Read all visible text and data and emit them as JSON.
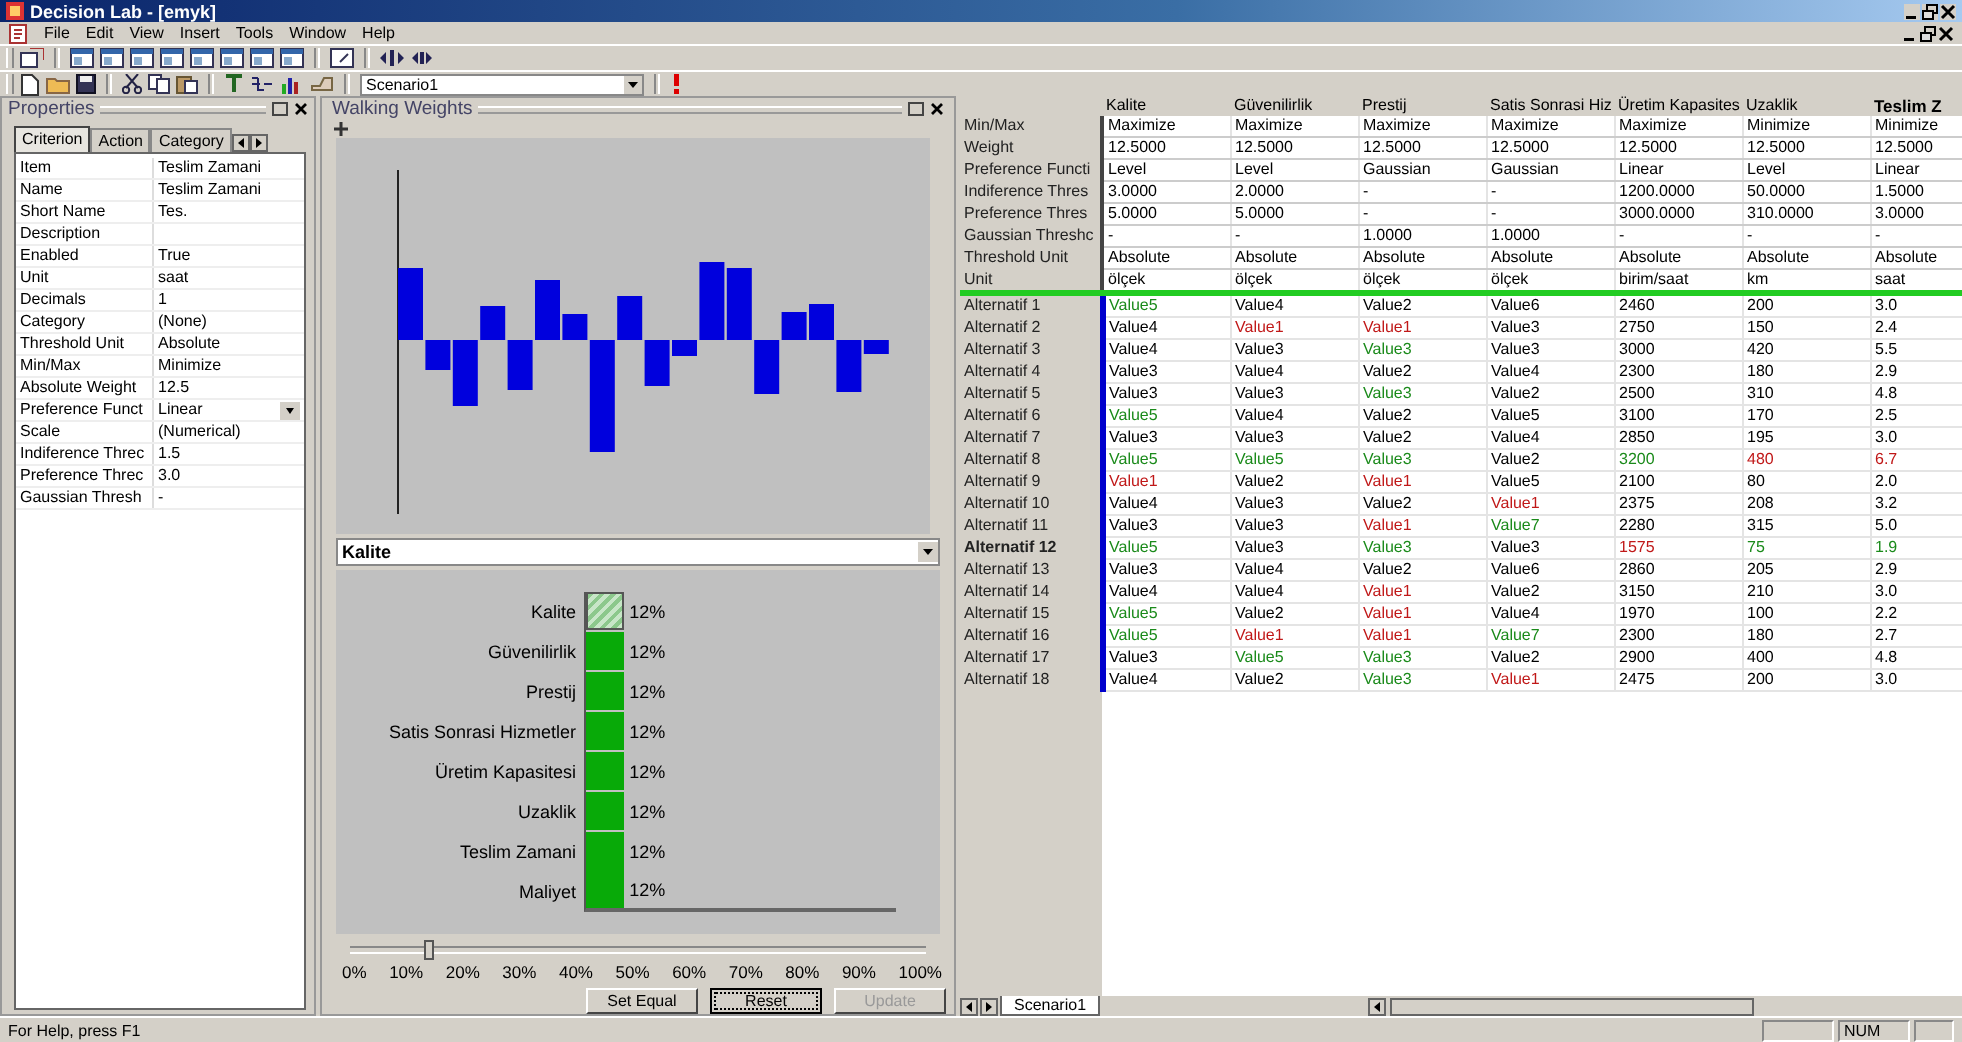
{
  "window": {
    "title": "Decision Lab - [emyk]"
  },
  "menu": [
    "File",
    "Edit",
    "View",
    "Insert",
    "Tools",
    "Window",
    "Help"
  ],
  "toolbar": {
    "scenario": "Scenario1"
  },
  "properties": {
    "title": "Properties",
    "tabs": [
      {
        "label": "Criterion",
        "selected": true
      },
      {
        "label": "Action",
        "selected": false
      },
      {
        "label": "Category",
        "selected": false
      }
    ],
    "rows": [
      {
        "name": "Item",
        "value": "Teslim Zamani",
        "kind": "text"
      },
      {
        "name": "Name",
        "value": "Teslim Zamani",
        "kind": "text"
      },
      {
        "name": "Short Name",
        "value": "Tes.",
        "kind": "text"
      },
      {
        "name": "Description",
        "kind": "text"
      },
      {
        "name": "Enabled",
        "value": "True",
        "kind": "text"
      },
      {
        "name": "Unit",
        "value": "saat",
        "kind": "text"
      },
      {
        "name": "Decimals",
        "value": "1",
        "kind": "text"
      },
      {
        "name": "Category",
        "value": "(None)",
        "kind": "text"
      },
      {
        "name": "Threshold Unit",
        "value": "Absolute",
        "kind": "text"
      },
      {
        "name": "Min/Max",
        "value": "Minimize",
        "kind": "text"
      },
      {
        "name": "Absolute Weight",
        "value": "12.5",
        "kind": "text"
      },
      {
        "name": "Preference Funct",
        "value": "Linear",
        "kind": "dropdown"
      },
      {
        "name": "Scale",
        "value": "(Numerical)",
        "kind": "text"
      },
      {
        "name": "Indiference Threc",
        "value": "1.5",
        "kind": "text"
      },
      {
        "name": "Preference Threc",
        "value": "3.0",
        "kind": "text"
      },
      {
        "name": "Gaussian Thresh",
        "value": "-",
        "kind": "text"
      }
    ]
  },
  "walking_weights": {
    "title": "Walking Weights",
    "criterion": "Kalite",
    "weights": [
      {
        "name": "Kalite",
        "percent": "12%",
        "level": 0.12,
        "selected": true
      },
      {
        "name": "Güvenilirlik",
        "percent": "12%",
        "level": 0.12,
        "selected": false
      },
      {
        "name": "Prestij",
        "percent": "12%",
        "level": 0.12,
        "selected": false
      },
      {
        "name": "Satis Sonrasi Hizmetler",
        "percent": "12%",
        "level": 0.12,
        "selected": false
      },
      {
        "name": "Üretim Kapasitesi",
        "percent": "12%",
        "level": 0.12,
        "selected": false
      },
      {
        "name": "Uzaklik",
        "percent": "12%",
        "level": 0.12,
        "selected": false
      },
      {
        "name": "Teslim Zamani",
        "percent": "12%",
        "level": 0.12,
        "selected": false
      },
      {
        "name": "Maliyet",
        "percent": "12%",
        "level": 0.12,
        "selected": false
      }
    ],
    "slider": {
      "level": 0.13,
      "ticks": [
        "0%",
        "10%",
        "20%",
        "30%",
        "40%",
        "50%",
        "60%",
        "70%",
        "80%",
        "90%",
        "100%"
      ]
    },
    "buttons": [
      {
        "label": "Set Equal",
        "disabled": false,
        "focused": false
      },
      {
        "label": "Reset",
        "disabled": false,
        "focused": true
      },
      {
        "label": "Update",
        "disabled": true,
        "focused": false
      }
    ]
  },
  "table": {
    "columns": [
      {
        "label": "Kalite",
        "selected": false
      },
      {
        "label": "Güvenilirlik",
        "selected": false
      },
      {
        "label": "Prestij",
        "selected": false
      },
      {
        "label": "Satis Sonrasi Hiz",
        "selected": false
      },
      {
        "label": "Üretim Kapasites",
        "selected": false
      },
      {
        "label": "Uzaklik",
        "selected": false
      },
      {
        "label": "Teslim Z",
        "selected": true
      }
    ],
    "settings": [
      {
        "label": "Min/Max",
        "cells": [
          "Maximize",
          "Maximize",
          "Maximize",
          "Maximize",
          "Maximize",
          "Minimize",
          "Minimize"
        ]
      },
      {
        "label": "Weight",
        "cells": [
          "12.5000",
          "12.5000",
          "12.5000",
          "12.5000",
          "12.5000",
          "12.5000",
          "12.5000"
        ]
      },
      {
        "label": "Preference Functi",
        "cells": [
          "Level",
          "Level",
          "Gaussian",
          "Gaussian",
          "Linear",
          "Level",
          "Linear"
        ]
      },
      {
        "label": "Indiference Thres",
        "cells": [
          "3.0000",
          "2.0000",
          "-",
          "-",
          "1200.0000",
          "50.0000",
          "1.5000"
        ]
      },
      {
        "label": "Preference Thres",
        "cells": [
          "5.0000",
          "5.0000",
          "-",
          "-",
          "3000.0000",
          "310.0000",
          "3.0000"
        ]
      },
      {
        "label": "Gaussian Threshc",
        "cells": [
          "-",
          "-",
          "1.0000",
          "1.0000",
          "-",
          "-",
          "-"
        ]
      },
      {
        "label": "Threshold Unit",
        "cells": [
          "Absolute",
          "Absolute",
          "Absolute",
          "Absolute",
          "Absolute",
          "Absolute",
          "Absolute"
        ]
      },
      {
        "label": "Unit",
        "cells": [
          "ölçek",
          "ölçek",
          "ölçek",
          "ölçek",
          "birim/saat",
          "km",
          "saat"
        ]
      }
    ],
    "rows": [
      {
        "label": "Alternatif 1",
        "selected": false,
        "cells": [
          {
            "text": "Value5",
            "color": "#1a8a1a"
          },
          "Value4",
          "Value2",
          "Value6",
          "2460",
          "200",
          "3.0"
        ]
      },
      {
        "label": "Alternatif 2",
        "selected": false,
        "cells": [
          "Value4",
          {
            "text": "Value1",
            "color": "#c01818"
          },
          {
            "text": "Value1",
            "color": "#c01818"
          },
          "Value3",
          "2750",
          "150",
          "2.4"
        ]
      },
      {
        "label": "Alternatif 3",
        "selected": false,
        "cells": [
          "Value4",
          "Value3",
          {
            "text": "Value3",
            "color": "#1a8a1a"
          },
          "Value3",
          "3000",
          "420",
          "5.5"
        ]
      },
      {
        "label": "Alternatif 4",
        "selected": false,
        "cells": [
          "Value3",
          "Value4",
          "Value2",
          "Value4",
          "2300",
          "180",
          "2.9"
        ]
      },
      {
        "label": "Alternatif 5",
        "selected": false,
        "cells": [
          "Value3",
          "Value3",
          {
            "text": "Value3",
            "color": "#1a8a1a"
          },
          "Value2",
          "2500",
          "310",
          "4.8"
        ]
      },
      {
        "label": "Alternatif 6",
        "selected": false,
        "cells": [
          {
            "text": "Value5",
            "color": "#1a8a1a"
          },
          "Value4",
          "Value2",
          "Value5",
          "3100",
          "170",
          "2.5"
        ]
      },
      {
        "label": "Alternatif 7",
        "selected": false,
        "cells": [
          "Value3",
          "Value3",
          "Value2",
          "Value4",
          "2850",
          "195",
          "3.0"
        ]
      },
      {
        "label": "Alternatif 8",
        "selected": false,
        "cells": [
          {
            "text": "Value5",
            "color": "#1a8a1a"
          },
          {
            "text": "Value5",
            "color": "#1a8a1a"
          },
          {
            "text": "Value3",
            "color": "#1a8a1a"
          },
          "Value2",
          {
            "text": "3200",
            "color": "#1a8a1a"
          },
          {
            "text": "480",
            "color": "#c01818"
          },
          {
            "text": "6.7",
            "color": "#c01818"
          }
        ]
      },
      {
        "label": "Alternatif 9",
        "selected": false,
        "cells": [
          {
            "text": "Value1",
            "color": "#c01818"
          },
          "Value2",
          {
            "text": "Value1",
            "color": "#c01818"
          },
          "Value5",
          "2100",
          "80",
          "2.0"
        ]
      },
      {
        "label": "Alternatif 10",
        "selected": false,
        "cells": [
          "Value4",
          "Value3",
          "Value2",
          {
            "text": "Value1",
            "color": "#c01818"
          },
          "2375",
          "208",
          "3.2"
        ]
      },
      {
        "label": "Alternatif 11",
        "selected": false,
        "cells": [
          "Value3",
          "Value3",
          {
            "text": "Value1",
            "color": "#c01818"
          },
          {
            "text": "Value7",
            "color": "#1a8a1a"
          },
          "2280",
          "315",
          "5.0"
        ]
      },
      {
        "label": "Alternatif 12",
        "selected": true,
        "cells": [
          {
            "text": "Value5",
            "color": "#1a8a1a"
          },
          "Value3",
          {
            "text": "Value3",
            "color": "#1a8a1a"
          },
          "Value3",
          {
            "text": "1575",
            "color": "#c01818"
          },
          {
            "text": "75",
            "color": "#1a8a1a"
          },
          {
            "text": "1.9",
            "color": "#1a8a1a"
          }
        ]
      },
      {
        "label": "Alternatif 13",
        "selected": false,
        "cells": [
          "Value3",
          "Value4",
          "Value2",
          "Value6",
          "2860",
          "205",
          "2.9"
        ]
      },
      {
        "label": "Alternatif 14",
        "selected": false,
        "cells": [
          "Value4",
          "Value4",
          {
            "text": "Value1",
            "color": "#c01818"
          },
          "Value2",
          "3150",
          "210",
          "3.0"
        ]
      },
      {
        "label": "Alternatif 15",
        "selected": false,
        "cells": [
          {
            "text": "Value5",
            "color": "#1a8a1a"
          },
          "Value2",
          {
            "text": "Value1",
            "color": "#c01818"
          },
          "Value4",
          "1970",
          "100",
          "2.2"
        ]
      },
      {
        "label": "Alternatif 16",
        "selected": false,
        "cells": [
          {
            "text": "Value5",
            "color": "#1a8a1a"
          },
          {
            "text": "Value1",
            "color": "#c01818"
          },
          {
            "text": "Value1",
            "color": "#c01818"
          },
          {
            "text": "Value7",
            "color": "#1a8a1a"
          },
          "2300",
          "180",
          "2.7"
        ]
      },
      {
        "label": "Alternatif 17",
        "selected": false,
        "cells": [
          "Value3",
          {
            "text": "Value5",
            "color": "#1a8a1a"
          },
          {
            "text": "Value3",
            "color": "#1a8a1a"
          },
          "Value2",
          "2900",
          "400",
          "4.8"
        ]
      },
      {
        "label": "Alternatif 18",
        "selected": false,
        "cells": [
          "Value4",
          "Value2",
          {
            "text": "Value3",
            "color": "#1a8a1a"
          },
          {
            "text": "Value1",
            "color": "#c01818"
          },
          "2475",
          "200",
          "3.0"
        ]
      }
    ]
  },
  "sheet_tabs": [
    {
      "label": "Scenario1",
      "selected": true
    }
  ],
  "status_bar": {
    "message": "For Help, press F1",
    "indicators": [
      "NUM"
    ]
  }
}
